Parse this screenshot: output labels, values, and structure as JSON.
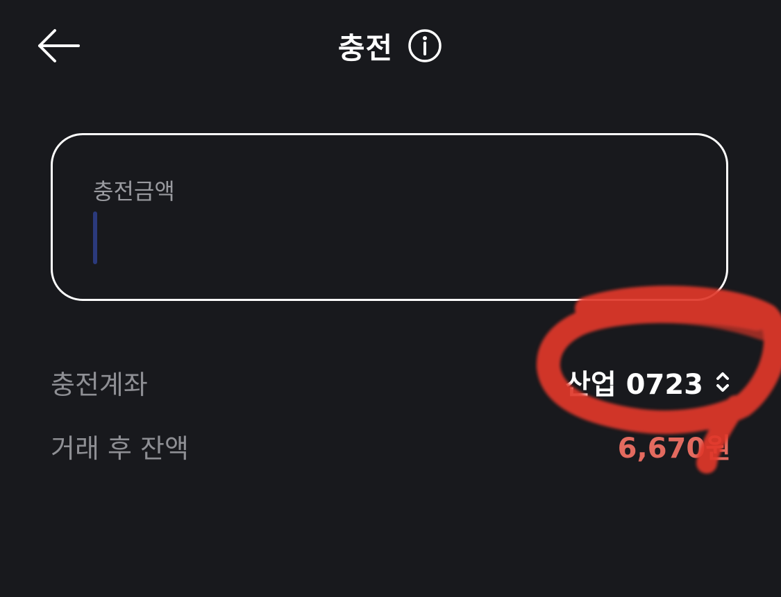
{
  "header": {
    "title": "충전",
    "back_icon": "arrow-left-icon",
    "info_icon": "info-circle-icon"
  },
  "amount": {
    "label": "충전금액",
    "value": "",
    "placeholder": ""
  },
  "account": {
    "label": "충전계좌",
    "value": "산업 0723",
    "selector_icon": "chevron-up-down-icon"
  },
  "balance": {
    "label": "거래 후 잔액",
    "value": "6,670원"
  },
  "colors": {
    "background": "#18191d",
    "caret": "#2b3a7c",
    "annotation": "#e0392b"
  }
}
